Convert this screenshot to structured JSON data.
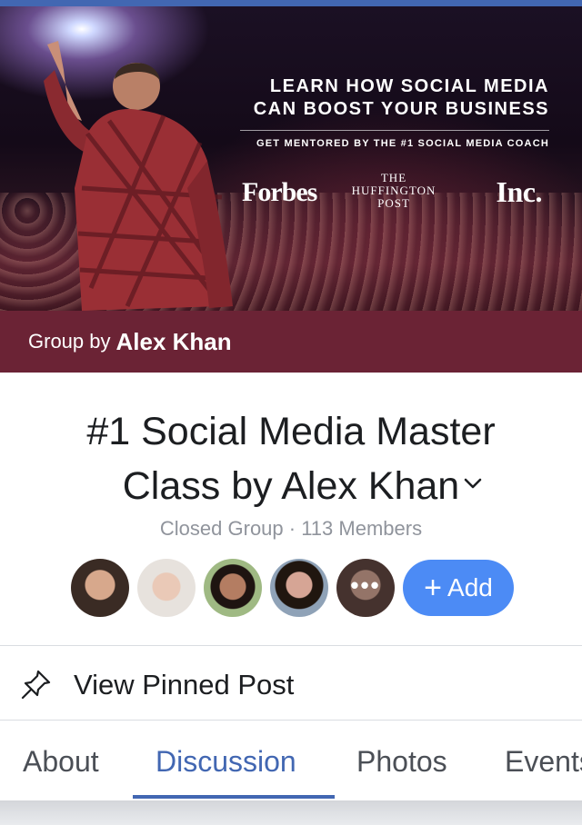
{
  "cover": {
    "headline_line1": "LEARN HOW SOCIAL MEDIA",
    "headline_line2": "CAN BOOST YOUR BUSINESS",
    "subline": "GET MENTORED BY THE #1 SOCIAL MEDIA COACH",
    "logos": {
      "forbes": "Forbes",
      "huffington_line1": "THE",
      "huffington_line2": "HUFFINGTON",
      "huffington_line3": "POST",
      "inc": "Inc."
    }
  },
  "group_banner": {
    "prefix": "Group by",
    "owner": "Alex Khan"
  },
  "group": {
    "title_line1": "#1 Social Media Master",
    "title_line2": "Class by Alex Khan",
    "meta": "Closed Group · 113 Members",
    "more_members": "•••",
    "add_label": "Add"
  },
  "pinned": {
    "label": "View Pinned Post"
  },
  "tabs": [
    {
      "label": "About",
      "active": false
    },
    {
      "label": "Discussion",
      "active": true
    },
    {
      "label": "Photos",
      "active": false
    },
    {
      "label": "Events",
      "active": false
    }
  ],
  "colors": {
    "accent": "#4267b2",
    "add_button": "#4c8bf5",
    "banner": "#6b2335"
  },
  "icons": [
    "chevron-down-icon",
    "pin-icon",
    "plus-icon",
    "more-icon"
  ]
}
